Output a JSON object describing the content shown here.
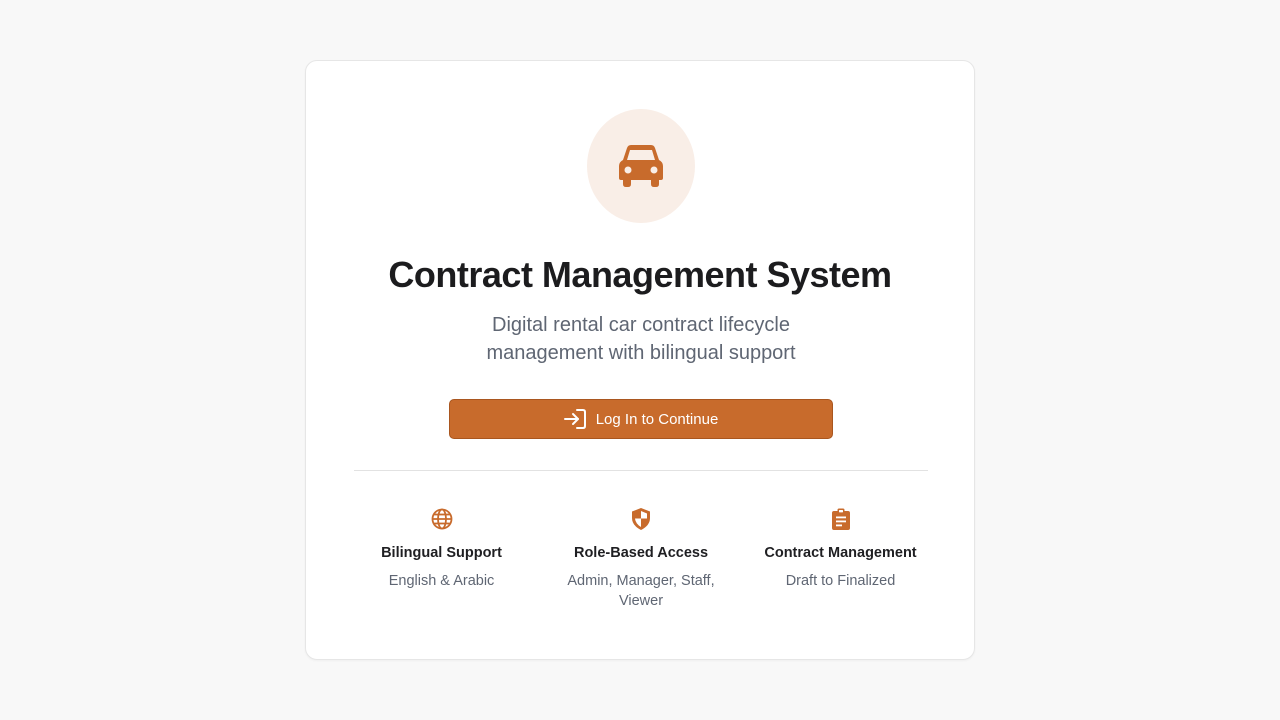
{
  "header": {
    "logo_icon": "car-icon",
    "title": "Contract Management System",
    "subtitle": "Digital rental car contract lifecycle management with bilingual support"
  },
  "login": {
    "icon": "log-in-icon",
    "label": "Log In to Continue"
  },
  "features": [
    {
      "icon": "globe-icon",
      "title": "Bilingual Support",
      "description": "English & Arabic"
    },
    {
      "icon": "shield-icon",
      "title": "Role-Based Access",
      "description": "Admin, Manager, Staff, Viewer"
    },
    {
      "icon": "clipboard-icon",
      "title": "Contract Management",
      "description": "Draft to Finalized"
    }
  ],
  "colors": {
    "accent": "#c86b2c",
    "accent_light": "#f9eee7",
    "background": "#f8f8f8",
    "text_primary": "#1c1c1e",
    "text_secondary": "#5f6673"
  }
}
